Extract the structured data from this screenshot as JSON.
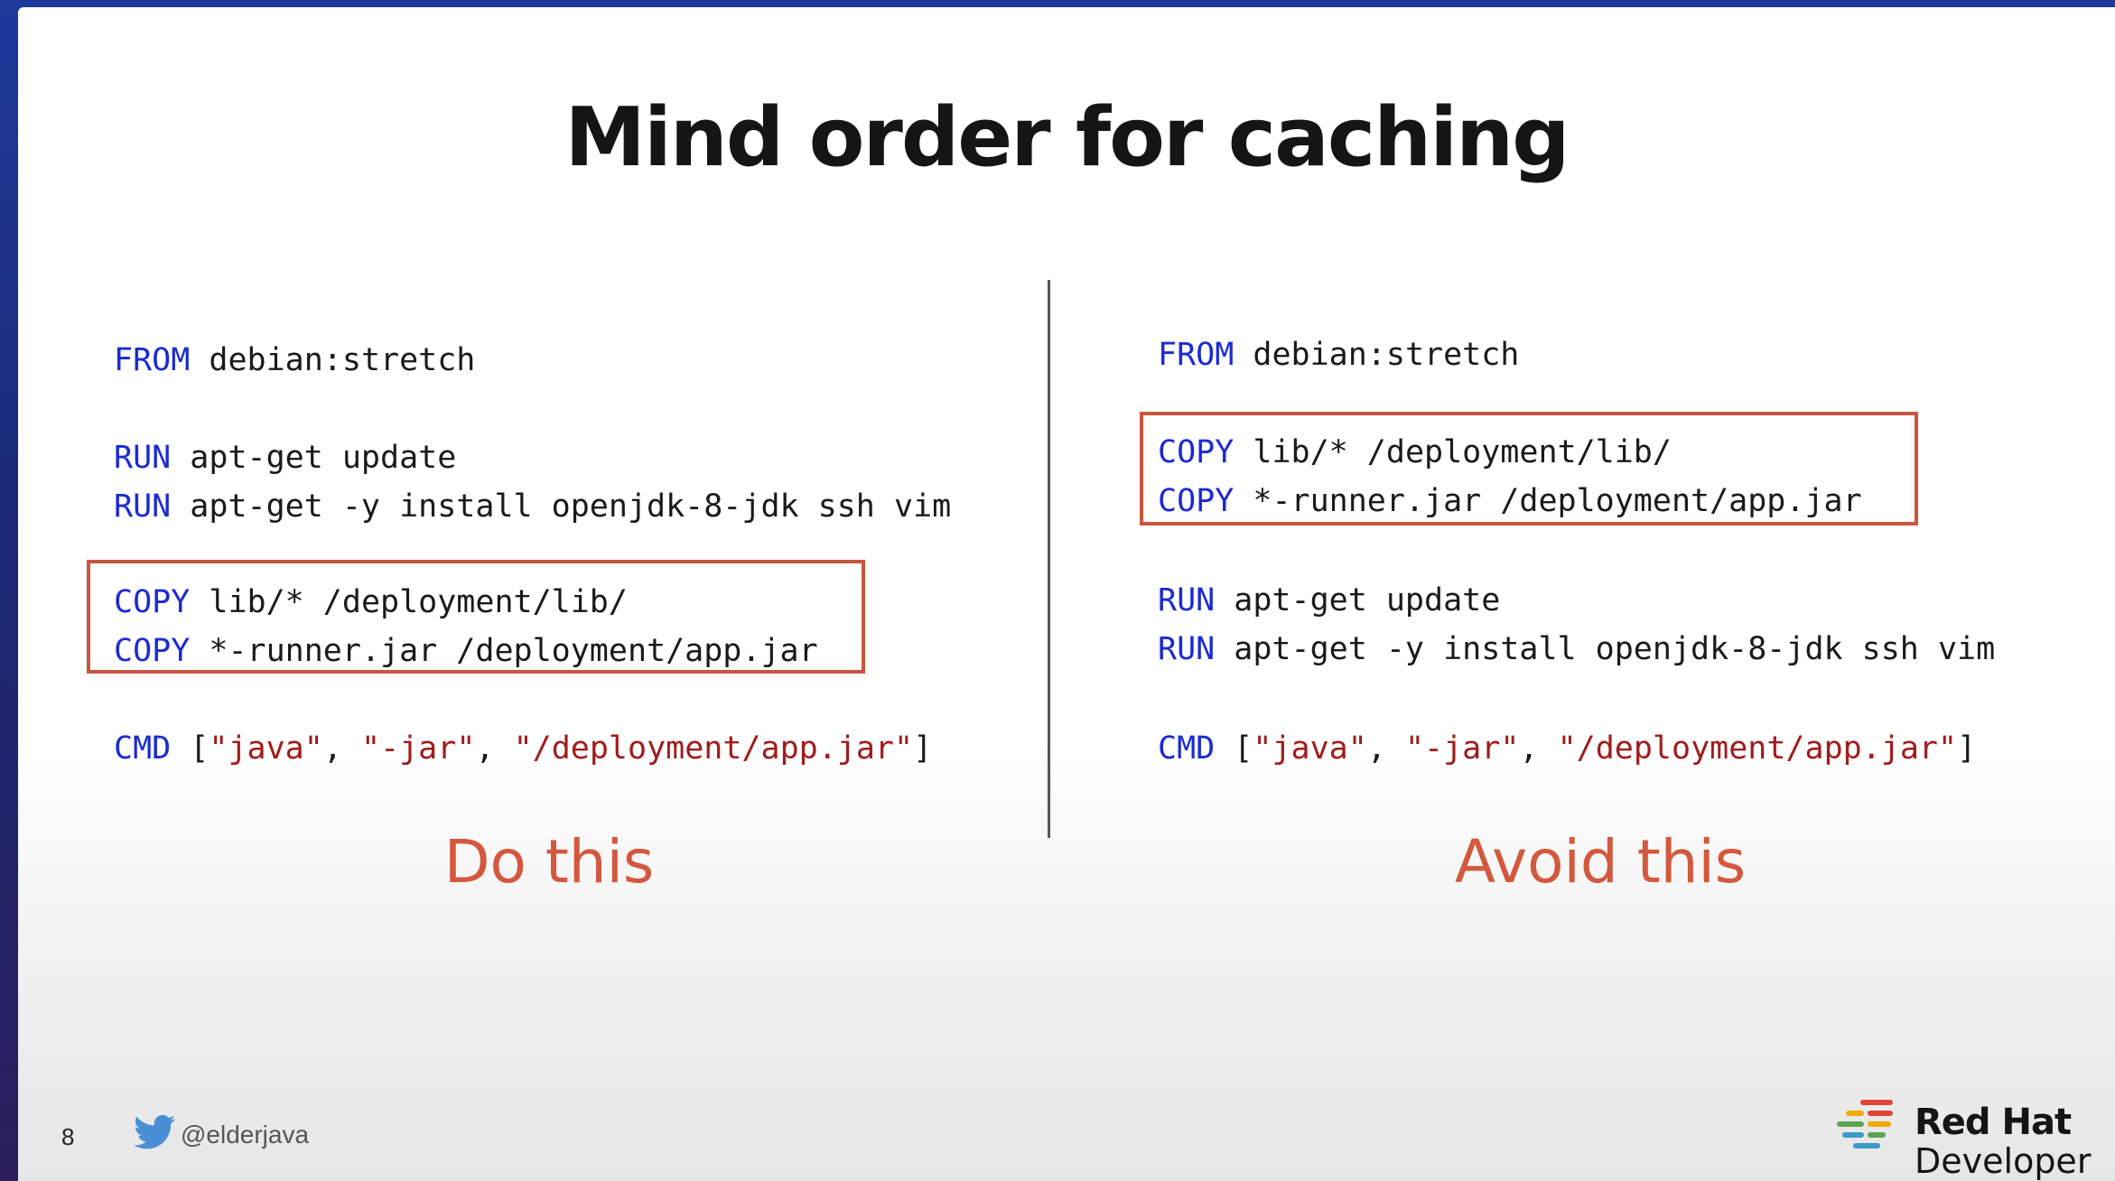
{
  "slide": {
    "title": "Mind order for caching",
    "page_number": "8",
    "twitter_handle": "@elderjava",
    "brand_line1": "Red Hat",
    "brand_line2": "Developer",
    "colors": {
      "keyword": "#1b2bd1",
      "string": "#a11c1c",
      "highlight_border": "#c8553d",
      "caption": "#d4583d"
    }
  },
  "left_panel": {
    "caption": "Do this",
    "lines": {
      "from_kw": "FROM",
      "from_arg": " debian:stretch",
      "run1_kw": "RUN",
      "run1_arg": " apt-get update",
      "run2_kw": "RUN",
      "run2_arg": " apt-get -y install openjdk-8-jdk ssh vim",
      "copy1_kw": "COPY",
      "copy1_arg": " lib/* /deployment/lib/",
      "copy2_kw": "COPY",
      "copy2_arg": " *-runner.jar /deployment/app.jar",
      "cmd_kw": "CMD",
      "cmd_open": " [",
      "cmd_s1": "\"java\"",
      "cmd_sep1": ", ",
      "cmd_s2": "\"-jar\"",
      "cmd_sep2": ", ",
      "cmd_s3": "\"/deployment/app.jar\"",
      "cmd_close": "]"
    }
  },
  "right_panel": {
    "caption": "Avoid this",
    "lines": {
      "from_kw": "FROM",
      "from_arg": " debian:stretch",
      "copy1_kw": "COPY",
      "copy1_arg": " lib/* /deployment/lib/",
      "copy2_kw": "COPY",
      "copy2_arg": " *-runner.jar /deployment/app.jar",
      "run1_kw": "RUN",
      "run1_arg": " apt-get update",
      "run2_kw": "RUN",
      "run2_arg": " apt-get -y install openjdk-8-jdk ssh vim",
      "cmd_kw": "CMD",
      "cmd_open": " [",
      "cmd_s1": "\"java\"",
      "cmd_sep1": ", ",
      "cmd_s2": "\"-jar\"",
      "cmd_sep2": ", ",
      "cmd_s3": "\"/deployment/app.jar\"",
      "cmd_close": "]"
    }
  }
}
